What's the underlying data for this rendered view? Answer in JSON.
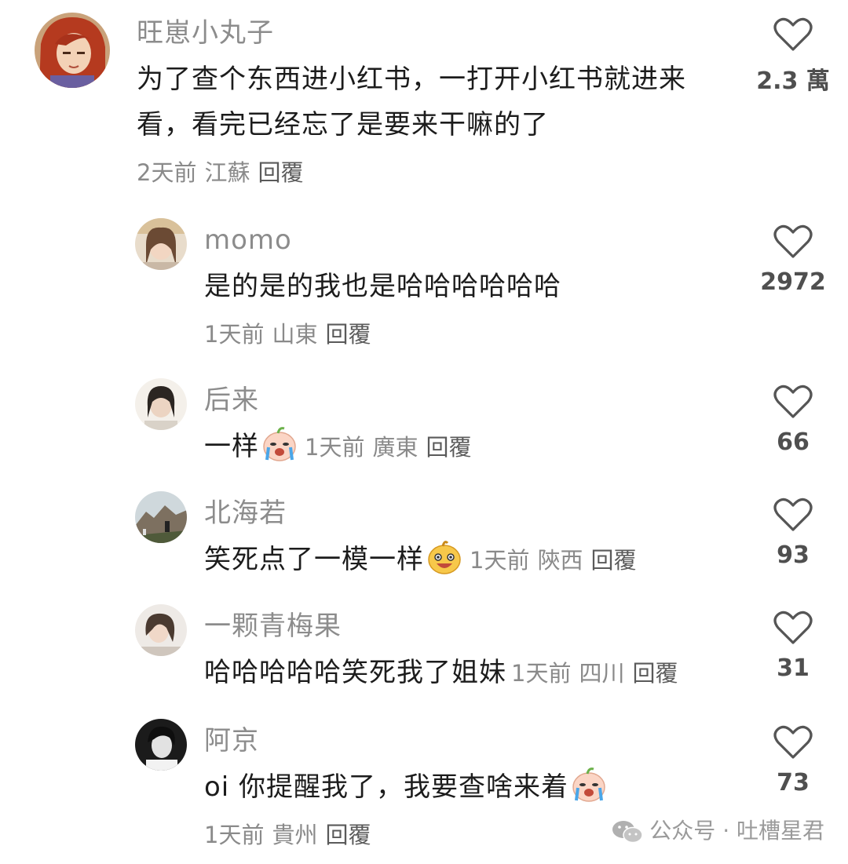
{
  "comments": [
    {
      "username": "旺崽小丸子",
      "lines": [
        "为了查个东西进小红书，一打开小红书就进来",
        "看，看完已经忘了是要来干嘛的了"
      ],
      "time": "2天前",
      "location": "江蘇",
      "reply": "回覆",
      "likes": "2.3 萬",
      "avatar": "anime-avatar"
    },
    {
      "username": "momo",
      "text": "是的是的我也是哈哈哈哈哈哈",
      "time": "1天前",
      "location": "山東",
      "reply": "回覆",
      "likes": "2972",
      "avatar": "photo-avatar"
    },
    {
      "username": "后来",
      "text": "一样",
      "emoji": "crying-emoji",
      "time": "1天前",
      "location": "廣東",
      "reply": "回覆",
      "likes": "66",
      "avatar": "photo-avatar"
    },
    {
      "username": "北海若",
      "text": "笑死点了一模一样",
      "emoji": "grinning-emoji",
      "time": "1天前",
      "location": "陝西",
      "reply": "回覆",
      "likes": "93",
      "avatar": "landscape-avatar"
    },
    {
      "username": "一颗青梅果",
      "text": "哈哈哈哈哈笑死我了姐妹",
      "time": "1天前",
      "location": "四川",
      "reply": "回覆",
      "likes": "31",
      "avatar": "photo-avatar"
    },
    {
      "username": "阿京",
      "text": "oi 你提醒我了，我要查啥来着",
      "emoji": "crying-emoji",
      "time": "1天前",
      "location": "貴州",
      "reply": "回覆",
      "likes": "73",
      "avatar": "photo-avatar"
    }
  ],
  "icons": {
    "like": "heart-outline-icon",
    "watermark": "wechat-icon"
  },
  "watermark": {
    "text": "公众号 · 吐槽星君"
  },
  "colors": {
    "username": "#8c8c8c",
    "text": "#1c1c1c",
    "meta": "#8a8a8a",
    "reply": "#5a5a5a",
    "count": "#4f4f4f"
  }
}
